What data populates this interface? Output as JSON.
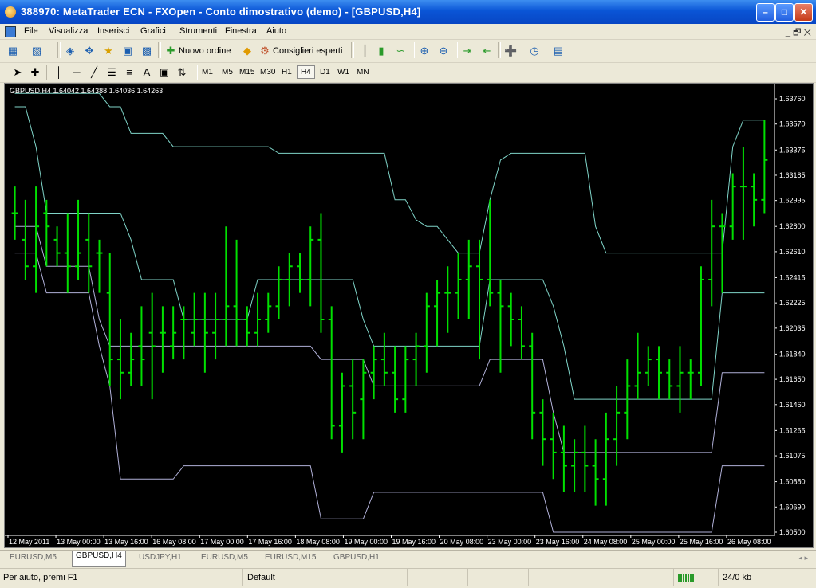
{
  "window": {
    "title": "388970: MetaTrader ECN - FXOpen - Conto dimostrativo (demo) - [GBPUSD,H4]",
    "controls": [
      "minimize",
      "maximize",
      "close"
    ]
  },
  "menu": {
    "items": [
      "File",
      "Visualizza",
      "Inserisci",
      "Grafici",
      "Strumenti",
      "Finestra",
      "Aiuto"
    ],
    "mdi_controls": "_ 🗗 ✕"
  },
  "toolbar": {
    "new_order_label": "Nuovo ordine",
    "expert_advisors_label": "Consiglieri esperti",
    "icons": [
      "new-chart-icon",
      "profiles-icon",
      "market-watch-icon",
      "navigator-icon",
      "data-window-icon",
      "terminal-icon",
      "tester-icon",
      "new-order-icon",
      "alert-icon",
      "experts-icon",
      "bar-chart-icon",
      "candlestick-icon",
      "line-chart-icon",
      "zoom-in-icon",
      "zoom-out-icon",
      "autoscroll-icon",
      "chart-shift-icon",
      "indicators-icon",
      "periods-icon",
      "templates-icon"
    ]
  },
  "drawing_toolbar": {
    "text_tool": "A",
    "timeframes": [
      "M1",
      "M5",
      "M15",
      "M30",
      "H1",
      "H4",
      "D1",
      "W1",
      "MN"
    ],
    "active_timeframe": "H4"
  },
  "chart": {
    "ohlc_header": "GBPUSD,H4  1.64042 1.64388 1.64036 1.64263",
    "price_labels": [
      "1.63760",
      "1.63570",
      "1.63375",
      "1.63185",
      "1.62995",
      "1.62800",
      "1.62610",
      "1.62415",
      "1.62225",
      "1.62035",
      "1.61840",
      "1.61650",
      "1.61460",
      "1.61265",
      "1.61075",
      "1.60880",
      "1.60690",
      "1.60500"
    ],
    "time_labels": [
      "12 May 2011",
      "13 May 00:00",
      "13 May 16:00",
      "16 May 08:00",
      "17 May 00:00",
      "17 May 16:00",
      "18 May 08:00",
      "19 May 00:00",
      "19 May 16:00",
      "20 May 08:00",
      "23 May 00:00",
      "23 May 16:00",
      "24 May 08:00",
      "25 May 00:00",
      "25 May 16:00",
      "26 May 08:00"
    ],
    "colors": {
      "background": "#000000",
      "bars": "#00e000",
      "envelope_outer": "#7fd4c8",
      "envelope_inner": "#b0b0d8",
      "text": "#ffffff"
    }
  },
  "chart_data": {
    "type": "ohlc",
    "symbol": "GBPUSD",
    "timeframe": "H4",
    "ylim": [
      1.605,
      1.6385
    ],
    "y_ticks": [
      1.6376,
      1.6357,
      1.63375,
      1.63185,
      1.62995,
      1.628,
      1.6261,
      1.62415,
      1.62225,
      1.62035,
      1.6184,
      1.6165,
      1.6146,
      1.61265,
      1.61075,
      1.6088,
      1.6069,
      1.605
    ],
    "bars": [
      [
        1.629,
        1.631,
        1.627,
        1.629
      ],
      [
        1.627,
        1.63,
        1.624,
        1.625
      ],
      [
        1.625,
        1.631,
        1.623,
        1.628
      ],
      [
        1.629,
        1.63,
        1.625,
        1.628
      ],
      [
        1.627,
        1.628,
        1.625,
        1.626
      ],
      [
        1.626,
        1.629,
        1.623,
        1.625
      ],
      [
        1.625,
        1.63,
        1.624,
        1.626
      ],
      [
        1.627,
        1.629,
        1.623,
        1.625
      ],
      [
        1.626,
        1.627,
        1.623,
        1.626
      ],
      [
        1.623,
        1.626,
        1.616,
        1.618
      ],
      [
        1.618,
        1.621,
        1.615,
        1.617
      ],
      [
        1.617,
        1.62,
        1.616,
        1.618
      ],
      [
        1.619,
        1.622,
        1.616,
        1.618
      ],
      [
        1.62,
        1.623,
        1.615,
        1.619
      ],
      [
        1.62,
        1.622,
        1.617,
        1.62
      ],
      [
        1.619,
        1.622,
        1.618,
        1.62
      ],
      [
        1.621,
        1.622,
        1.618,
        1.621
      ],
      [
        1.62,
        1.623,
        1.619,
        1.621
      ],
      [
        1.621,
        1.623,
        1.617,
        1.62
      ],
      [
        1.62,
        1.623,
        1.618,
        1.621
      ],
      [
        1.621,
        1.628,
        1.619,
        1.622
      ],
      [
        1.622,
        1.627,
        1.619,
        1.621
      ],
      [
        1.621,
        1.622,
        1.619,
        1.62
      ],
      [
        1.62,
        1.623,
        1.619,
        1.621
      ],
      [
        1.621,
        1.623,
        1.62,
        1.622
      ],
      [
        1.622,
        1.625,
        1.621,
        1.624
      ],
      [
        1.624,
        1.626,
        1.622,
        1.625
      ],
      [
        1.625,
        1.626,
        1.623,
        1.624
      ],
      [
        1.624,
        1.628,
        1.622,
        1.627
      ],
      [
        1.627,
        1.629,
        1.62,
        1.621
      ],
      [
        1.621,
        1.622,
        1.612,
        1.613
      ],
      [
        1.613,
        1.617,
        1.611,
        1.616
      ],
      [
        1.616,
        1.618,
        1.612,
        1.614
      ],
      [
        1.615,
        1.618,
        1.612,
        1.617
      ],
      [
        1.617,
        1.619,
        1.615,
        1.618
      ],
      [
        1.618,
        1.62,
        1.616,
        1.617
      ],
      [
        1.617,
        1.619,
        1.614,
        1.615
      ],
      [
        1.615,
        1.619,
        1.614,
        1.618
      ],
      [
        1.618,
        1.62,
        1.616,
        1.619
      ],
      [
        1.619,
        1.623,
        1.617,
        1.622
      ],
      [
        1.622,
        1.624,
        1.619,
        1.623
      ],
      [
        1.623,
        1.625,
        1.62,
        1.623
      ],
      [
        1.623,
        1.626,
        1.621,
        1.624
      ],
      [
        1.624,
        1.627,
        1.621,
        1.625
      ],
      [
        1.625,
        1.627,
        1.618,
        1.624
      ],
      [
        1.624,
        1.63,
        1.622,
        1.623
      ],
      [
        1.623,
        1.624,
        1.617,
        1.622
      ],
      [
        1.622,
        1.623,
        1.619,
        1.621
      ],
      [
        1.621,
        1.622,
        1.618,
        1.619
      ],
      [
        1.619,
        1.62,
        1.612,
        1.614
      ],
      [
        1.614,
        1.615,
        1.61,
        1.612
      ],
      [
        1.612,
        1.614,
        1.609,
        1.611
      ],
      [
        1.611,
        1.613,
        1.608,
        1.61
      ],
      [
        1.61,
        1.612,
        1.608,
        1.611
      ],
      [
        1.611,
        1.613,
        1.608,
        1.61
      ],
      [
        1.61,
        1.612,
        1.607,
        1.609
      ],
      [
        1.609,
        1.614,
        1.607,
        1.612
      ],
      [
        1.612,
        1.616,
        1.61,
        1.614
      ],
      [
        1.614,
        1.618,
        1.612,
        1.616
      ],
      [
        1.616,
        1.62,
        1.615,
        1.617
      ],
      [
        1.617,
        1.619,
        1.616,
        1.618
      ],
      [
        1.618,
        1.619,
        1.615,
        1.617
      ],
      [
        1.617,
        1.618,
        1.615,
        1.616
      ],
      [
        1.616,
        1.619,
        1.614,
        1.617
      ],
      [
        1.617,
        1.618,
        1.615,
        1.617
      ],
      [
        1.617,
        1.625,
        1.616,
        1.624
      ],
      [
        1.624,
        1.63,
        1.622,
        1.628
      ],
      [
        1.628,
        1.629,
        1.623,
        1.628
      ],
      [
        1.628,
        1.632,
        1.627,
        1.631
      ],
      [
        1.631,
        1.634,
        1.627,
        1.631
      ],
      [
        1.631,
        1.632,
        1.628,
        1.63
      ],
      [
        1.63,
        1.636,
        1.629,
        1.633
      ]
    ],
    "envelopes": [
      {
        "name": "upper-outer",
        "values": [
          1.638,
          1.638,
          1.638,
          1.638,
          1.638,
          1.638,
          1.638,
          1.638,
          1.638,
          1.637,
          1.637,
          1.635,
          1.635,
          1.635,
          1.635,
          1.634,
          1.634,
          1.634,
          1.634,
          1.634,
          1.634,
          1.634,
          1.634,
          1.634,
          1.634,
          1.6335,
          1.6335,
          1.6335,
          1.6335,
          1.6335,
          1.6335,
          1.6335,
          1.6335,
          1.6335,
          1.6335,
          1.6335,
          1.63,
          1.63,
          1.6285,
          1.628,
          1.628,
          1.627,
          1.626,
          1.626,
          1.626,
          1.63,
          1.633,
          1.6335,
          1.6335,
          1.6335,
          1.6335,
          1.6335,
          1.6335,
          1.6335,
          1.6335,
          1.628,
          1.626,
          1.626,
          1.626,
          1.626,
          1.626,
          1.626,
          1.626,
          1.626,
          1.626,
          1.626,
          1.626,
          1.626,
          1.634,
          1.636,
          1.636,
          1.636
        ]
      },
      {
        "name": "upper-inner",
        "values": [
          1.637,
          1.637,
          1.634,
          1.629,
          1.629,
          1.629,
          1.629,
          1.629,
          1.629,
          1.629,
          1.629,
          1.627,
          1.624,
          1.624,
          1.624,
          1.624,
          1.621,
          1.621,
          1.621,
          1.621,
          1.621,
          1.621,
          1.621,
          1.624,
          1.624,
          1.624,
          1.624,
          1.624,
          1.624,
          1.624,
          1.624,
          1.624,
          1.624,
          1.621,
          1.619,
          1.619,
          1.619,
          1.619,
          1.619,
          1.619,
          1.619,
          1.619,
          1.619,
          1.619,
          1.619,
          1.624,
          1.624,
          1.624,
          1.624,
          1.624,
          1.624,
          1.622,
          1.619,
          1.615,
          1.615,
          1.615,
          1.615,
          1.615,
          1.615,
          1.615,
          1.615,
          1.615,
          1.615,
          1.615,
          1.615,
          1.615,
          1.615,
          1.623,
          1.623,
          1.623,
          1.623,
          1.623
        ]
      },
      {
        "name": "lower-inner",
        "values": [
          1.628,
          1.628,
          1.628,
          1.625,
          1.625,
          1.625,
          1.625,
          1.625,
          1.621,
          1.619,
          1.619,
          1.619,
          1.619,
          1.619,
          1.619,
          1.619,
          1.619,
          1.619,
          1.619,
          1.619,
          1.619,
          1.619,
          1.619,
          1.619,
          1.619,
          1.619,
          1.619,
          1.619,
          1.619,
          1.618,
          1.618,
          1.618,
          1.618,
          1.618,
          1.616,
          1.616,
          1.616,
          1.616,
          1.616,
          1.616,
          1.616,
          1.616,
          1.616,
          1.616,
          1.616,
          1.618,
          1.618,
          1.618,
          1.618,
          1.618,
          1.618,
          1.614,
          1.611,
          1.611,
          1.611,
          1.611,
          1.611,
          1.611,
          1.611,
          1.611,
          1.611,
          1.611,
          1.611,
          1.611,
          1.611,
          1.611,
          1.611,
          1.617,
          1.617,
          1.617,
          1.617,
          1.617
        ]
      },
      {
        "name": "lower-outer",
        "values": [
          1.626,
          1.626,
          1.626,
          1.623,
          1.623,
          1.623,
          1.623,
          1.623,
          1.619,
          1.616,
          1.609,
          1.609,
          1.609,
          1.609,
          1.609,
          1.609,
          1.61,
          1.61,
          1.61,
          1.61,
          1.61,
          1.61,
          1.61,
          1.61,
          1.61,
          1.61,
          1.61,
          1.61,
          1.61,
          1.606,
          1.606,
          1.606,
          1.606,
          1.606,
          1.608,
          1.608,
          1.608,
          1.608,
          1.608,
          1.608,
          1.608,
          1.608,
          1.608,
          1.608,
          1.608,
          1.608,
          1.608,
          1.608,
          1.608,
          1.608,
          1.608,
          1.605,
          1.605,
          1.605,
          1.605,
          1.605,
          1.605,
          1.605,
          1.605,
          1.605,
          1.605,
          1.605,
          1.605,
          1.605,
          1.605,
          1.605,
          1.605,
          1.61,
          1.61,
          1.61,
          1.61,
          1.61
        ]
      }
    ]
  },
  "tabs": {
    "items": [
      "EURUSD,M5",
      "GBPUSD,H4",
      "USDJPY,H1",
      "EURUSD,M5",
      "EURUSD,M15",
      "GBPUSD,H1"
    ],
    "active_index": 1,
    "scroll": "◂ ▸"
  },
  "status": {
    "help": "Per aiuto, premi F1",
    "profile": "Default",
    "traffic": "24/0 kb"
  }
}
